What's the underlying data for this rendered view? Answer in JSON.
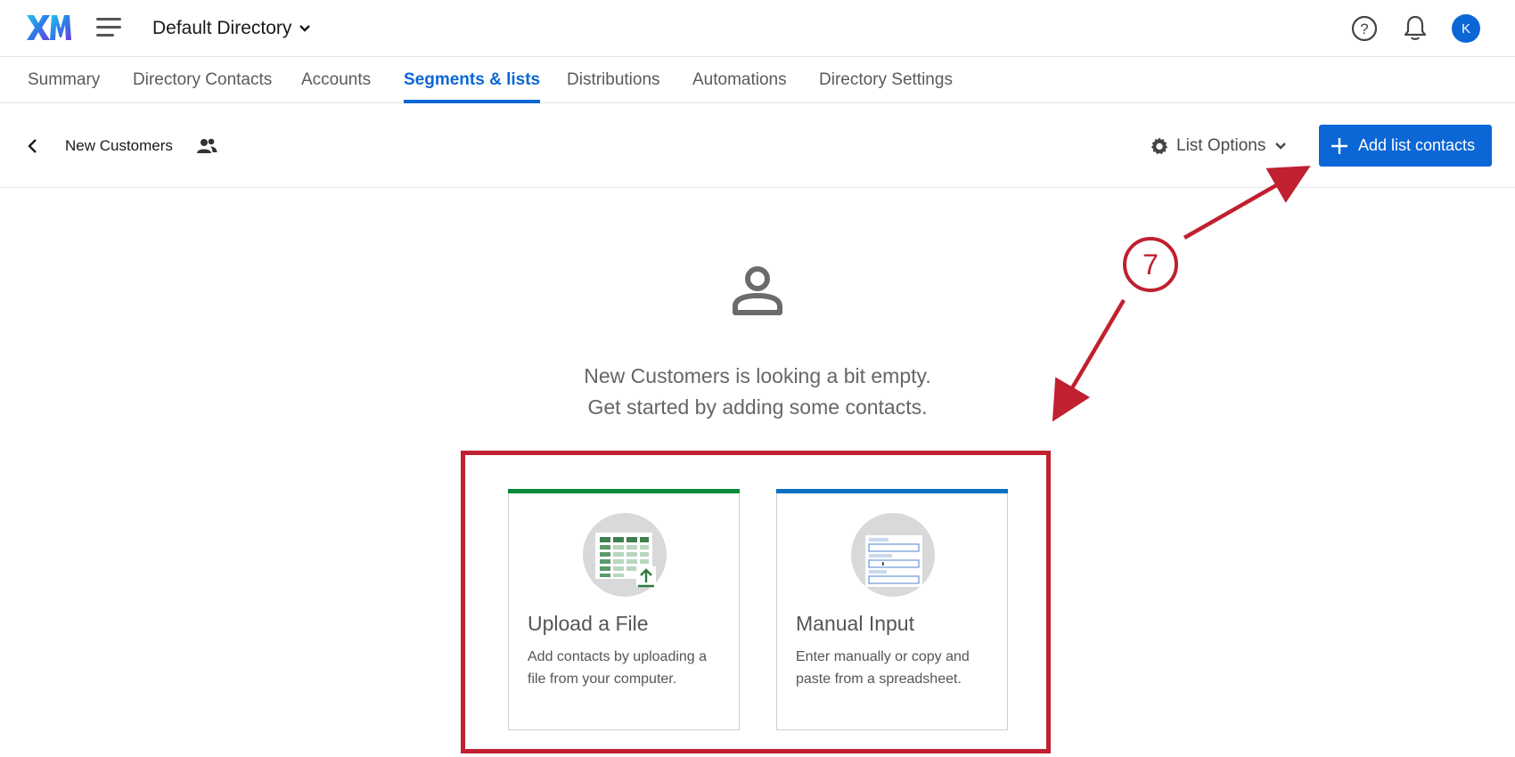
{
  "header": {
    "logo_text": "XM",
    "directory_label": "Default Directory",
    "avatar_initial": "K"
  },
  "nav": {
    "tabs": [
      {
        "label": "Summary"
      },
      {
        "label": "Directory Contacts"
      },
      {
        "label": "Accounts"
      },
      {
        "label": "Segments & lists",
        "active": true
      },
      {
        "label": "Distributions"
      },
      {
        "label": "Automations"
      },
      {
        "label": "Directory Settings"
      }
    ]
  },
  "list": {
    "name": "New Customers",
    "options_label": "List Options",
    "add_button_label": "Add list contacts"
  },
  "empty_state": {
    "line1": "New Customers is looking a bit empty.",
    "line2": "Get started by adding some contacts."
  },
  "cards": {
    "upload": {
      "title": "Upload a File",
      "description": "Add contacts by uploading a file from your computer.",
      "accent": "#0a8a3a"
    },
    "manual": {
      "title": "Manual Input",
      "description": "Enter manually or copy and paste from a spreadsheet.",
      "accent": "#0b6fc2"
    }
  },
  "annotation": {
    "step_number": "7",
    "color": "#c0202f"
  },
  "colors": {
    "brand_blue": "#0b66d6"
  },
  "icons": [
    "xm-logo-icon",
    "hamburger-menu-icon",
    "chevron-down-icon",
    "help-icon",
    "bell-icon",
    "chevron-left-icon",
    "people-icon",
    "gear-icon",
    "plus-icon",
    "person-icon",
    "spreadsheet-upload-icon",
    "form-input-icon"
  ]
}
